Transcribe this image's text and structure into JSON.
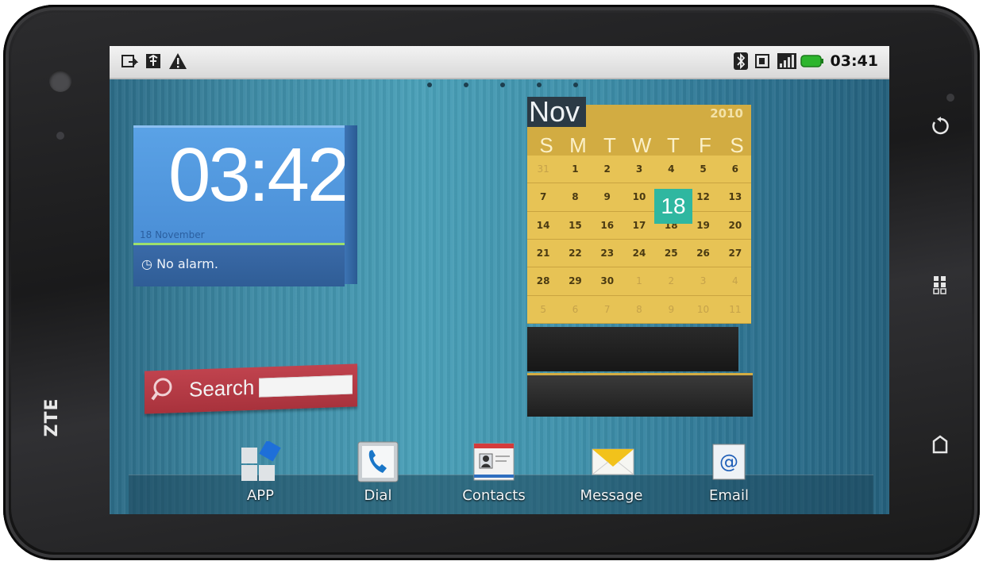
{
  "device": {
    "brand": "ZTE"
  },
  "status_bar": {
    "left_icons": [
      "screenshot-icon",
      "usb-debug-icon",
      "warning-icon"
    ],
    "right_icons": [
      "bluetooth-icon",
      "sim-icon",
      "signal-icon",
      "battery-icon"
    ],
    "time": "03:41"
  },
  "home_pages": {
    "count": 5
  },
  "clock_widget": {
    "time": "03:42",
    "date": "18 November",
    "alarm": "No alarm."
  },
  "search_widget": {
    "label": "Search"
  },
  "calendar_widget": {
    "month": "Nov",
    "year": "2010",
    "weekdays": [
      "S",
      "M",
      "T",
      "W",
      "T",
      "F",
      "S"
    ],
    "today": "18",
    "weeks": [
      [
        "31",
        "1",
        "2",
        "3",
        "4",
        "5",
        "6"
      ],
      [
        "7",
        "8",
        "9",
        "10",
        "11",
        "12",
        "13"
      ],
      [
        "14",
        "15",
        "16",
        "17",
        "18",
        "19",
        "20"
      ],
      [
        "21",
        "22",
        "23",
        "24",
        "25",
        "26",
        "27"
      ],
      [
        "28",
        "29",
        "30",
        "1",
        "2",
        "3",
        "4"
      ],
      [
        "5",
        "6",
        "7",
        "8",
        "9",
        "10",
        "11"
      ]
    ]
  },
  "dock": [
    {
      "label": "APP",
      "icon": "apps-grid-icon"
    },
    {
      "label": "Dial",
      "icon": "phone-icon"
    },
    {
      "label": "Contacts",
      "icon": "contacts-card-icon"
    },
    {
      "label": "Message",
      "icon": "envelope-icon"
    },
    {
      "label": "Email",
      "icon": "email-at-icon"
    }
  ],
  "hardware_keys": [
    "back-icon",
    "menu-icon",
    "home-icon"
  ],
  "colors": {
    "clock_blue": "#4a8ed6",
    "search_red": "#b23a44",
    "calendar_gold": "#e7c355",
    "today_teal": "#2fb7a0"
  }
}
